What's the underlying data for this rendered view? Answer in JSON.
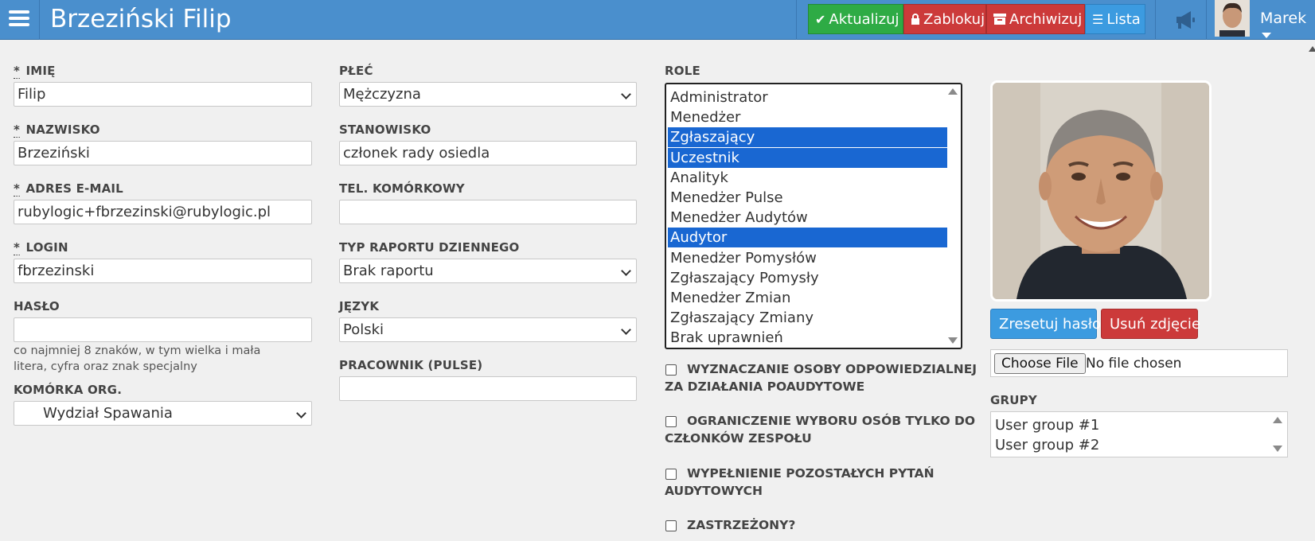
{
  "header": {
    "title": "Brzeziński Filip",
    "buttons": {
      "update": "Aktualizuj",
      "lock": "Zablokuj",
      "archive": "Archiwizuj",
      "list": "Lista"
    },
    "user_name": "Marek",
    "icons": {
      "menu": "hamburger-icon",
      "update": "check-icon",
      "lock": "lock-icon",
      "archive": "archive-icon",
      "list": "list-icon",
      "announcements": "megaphone-icon",
      "user_menu": "caret-down-icon"
    }
  },
  "form": {
    "first_name": {
      "label": "Imię",
      "value": "Filip",
      "required_mark": "*"
    },
    "last_name": {
      "label": "Nazwisko",
      "value": "Brzeziński",
      "required_mark": "*"
    },
    "email": {
      "label": "Adres e-mail",
      "value": "rubylogic+fbrzezinski@rubylogic.pl",
      "required_mark": "*"
    },
    "login": {
      "label": "Login",
      "value": "fbrzezinski",
      "required_mark": "*"
    },
    "password": {
      "label": "Hasło",
      "value": "",
      "hint": "co najmniej 8 znaków, w tym wielka i mała litera, cyfra oraz znak specjalny"
    },
    "org_unit": {
      "label": "Komórka org.",
      "selected": "Wydział Spawania"
    },
    "gender": {
      "label": "Płeć",
      "selected": "Mężczyzna"
    },
    "position": {
      "label": "Stanowisko",
      "value": "członek rady osiedla"
    },
    "mobile": {
      "label": "Tel. komórkowy",
      "value": ""
    },
    "daily_report": {
      "label": "Typ raportu dziennego",
      "selected": "Brak raportu"
    },
    "language": {
      "label": "Język",
      "selected": "Polski"
    },
    "pulse_employee": {
      "label": "Pracownik (Pulse)",
      "value": ""
    }
  },
  "roles": {
    "label": "Role",
    "options": [
      {
        "label": "Administrator",
        "selected": false
      },
      {
        "label": "Menedżer",
        "selected": false
      },
      {
        "label": "Zgłaszający",
        "selected": true
      },
      {
        "label": "Uczestnik",
        "selected": true
      },
      {
        "label": "Analityk",
        "selected": false
      },
      {
        "label": "Menedżer Pulse",
        "selected": false
      },
      {
        "label": "Menedżer Audytów",
        "selected": false
      },
      {
        "label": "Audytor",
        "selected": true
      },
      {
        "label": "Menedżer Pomysłów",
        "selected": false
      },
      {
        "label": "Zgłaszający Pomysły",
        "selected": false
      },
      {
        "label": "Menedżer Zmian",
        "selected": false
      },
      {
        "label": "Zgłaszający Zmiany",
        "selected": false
      },
      {
        "label": "Brak uprawnień",
        "selected": false
      }
    ],
    "selected_color": "#1967d2"
  },
  "checkboxes": [
    {
      "line1": "WYZNACZANIE OSOBY ODPOWIEDZIALNEJ",
      "line2": "ZA DZIAŁANIA POAUDYTOWE",
      "checked": false
    },
    {
      "line1": "OGRANICZENIE WYBORU OSÓB TYLKO DO",
      "line2": "CZŁONKÓW ZESPOŁU",
      "checked": false
    },
    {
      "line1": "WYPEŁNIENIE POZOSTAŁYCH PYTAŃ",
      "line2": "AUDYTOWYCH",
      "checked": false
    },
    {
      "line1": "ZASTRZEŻONY?",
      "line2": "",
      "checked": false
    }
  ],
  "photo": {
    "reset_password": "Zresetuj hasło",
    "remove_photo": "Usuń zdjęcie",
    "choose_file": "Choose File",
    "no_file": "No file chosen"
  },
  "groups": {
    "label": "Grupy",
    "options": [
      "User group #1",
      "User group #2"
    ]
  },
  "colors": {
    "header": "#4a8fcd",
    "green": "#2eab45",
    "red": "#cc3a3a",
    "blue": "#3c9be0"
  }
}
